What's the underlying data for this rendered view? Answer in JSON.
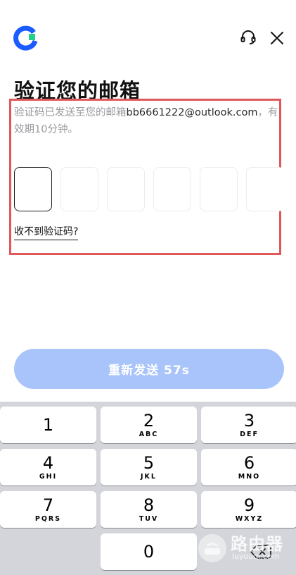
{
  "header": {
    "logo_icon": "app-logo-icon",
    "support_icon": "headset-icon",
    "close_icon": "close-icon"
  },
  "title": "验证您的邮箱",
  "description": {
    "prefix": "验证码已发送至您的邮箱",
    "email": "bb6661222@outlook.com",
    "suffix": "，有效期10分钟。"
  },
  "code_input": {
    "length": 6,
    "digits": [
      "",
      "",
      "",
      "",
      "",
      ""
    ],
    "active_index": 0
  },
  "resend_link": "收不到验证码?",
  "resend_button": "重新发送 57s",
  "keyboard": {
    "keys": [
      {
        "digit": "1",
        "letters": ""
      },
      {
        "digit": "2",
        "letters": "ABC"
      },
      {
        "digit": "3",
        "letters": "DEF"
      },
      {
        "digit": "4",
        "letters": "GHI"
      },
      {
        "digit": "5",
        "letters": "JKL"
      },
      {
        "digit": "6",
        "letters": "MNO"
      },
      {
        "digit": "7",
        "letters": "PQRS"
      },
      {
        "digit": "8",
        "letters": "TUV"
      },
      {
        "digit": "9",
        "letters": "WXYZ"
      },
      {
        "digit": "0",
        "letters": ""
      }
    ],
    "delete_icon": "backspace-icon"
  },
  "watermark": {
    "text": "路由器",
    "url": "luyouqi.com"
  },
  "colors": {
    "accent": "#a8c4fa",
    "logo_blue": "#1a5cff",
    "logo_green": "#1fd18a",
    "highlight_border": "#e0585a"
  }
}
